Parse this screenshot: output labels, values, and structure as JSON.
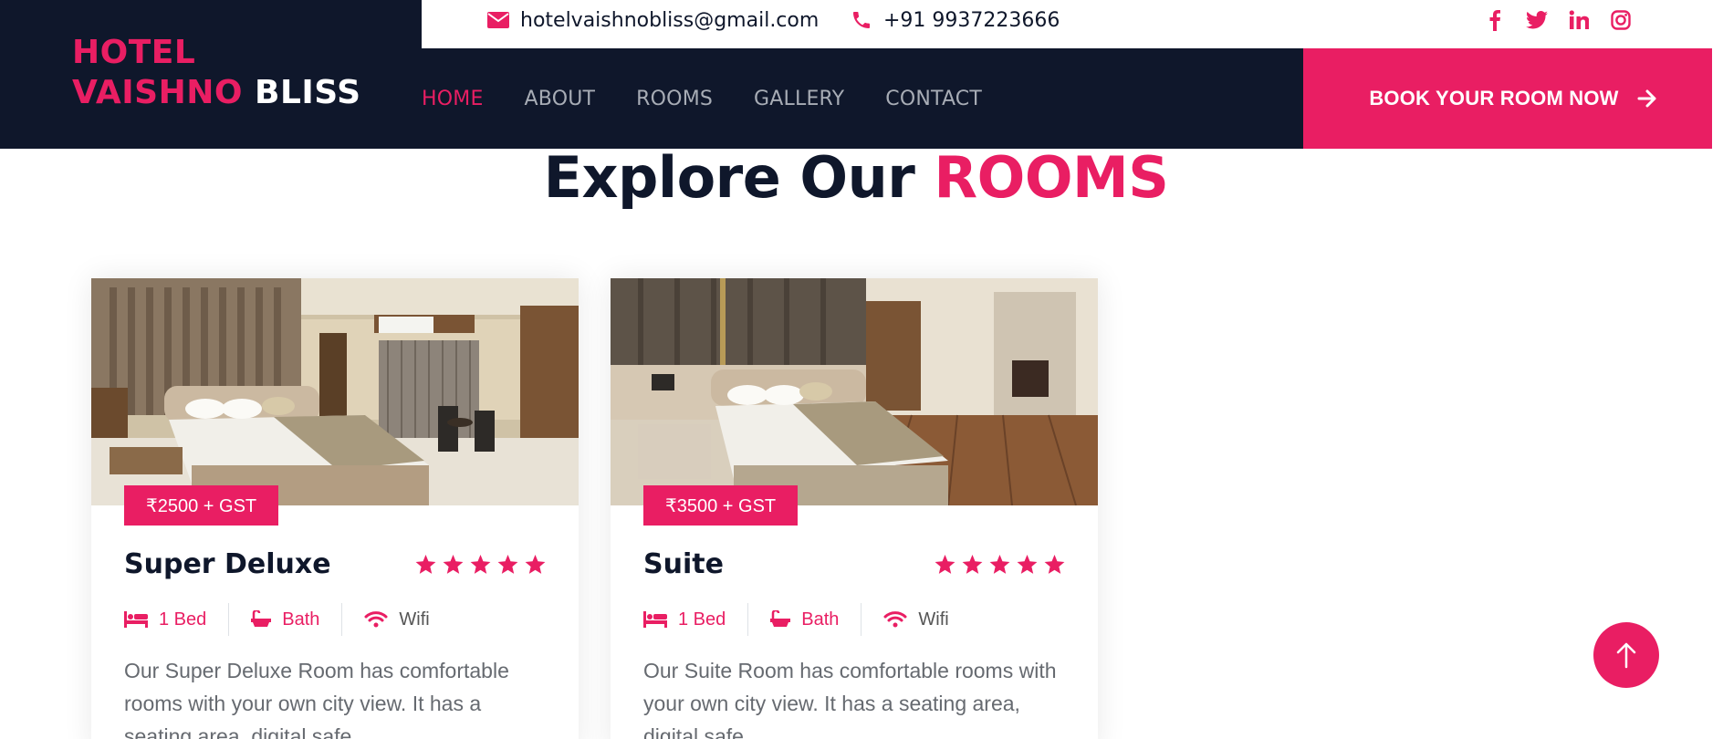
{
  "brand": {
    "line1": "HOTEL",
    "line2_a": "VAISHNO",
    "line2_b": "BLISS"
  },
  "topbar": {
    "email": "hotelvaishnobliss@gmail.com",
    "phone": "+91 9937223666",
    "socials": [
      "facebook-icon",
      "twitter-icon",
      "linkedin-icon",
      "instagram-icon"
    ]
  },
  "nav": {
    "items": [
      "HOME",
      "ABOUT",
      "ROOMS",
      "GALLERY",
      "CONTACT"
    ],
    "active": "HOME"
  },
  "book_button": {
    "label": "BOOK YOUR ROOM NOW"
  },
  "section": {
    "title_a": "Explore Our",
    "title_b": "ROOMS"
  },
  "rooms": [
    {
      "price": "₹2500 + GST",
      "name": "Super Deluxe",
      "rating": 5,
      "amenities": [
        "1 Bed",
        "Bath",
        "Wifi"
      ],
      "description": "Our Super Deluxe Room has comfortable rooms with your own city view. It has a seating area, digital safe"
    },
    {
      "price": "₹3500 + GST",
      "name": "Suite",
      "rating": 5,
      "amenities": [
        "1 Bed",
        "Bath",
        "Wifi"
      ],
      "description": "Our Suite Room has comfortable rooms with your own city view. It has a seating area, digital safe"
    }
  ],
  "colors": {
    "primary": "#e91e63",
    "dark": "#0f172b"
  }
}
